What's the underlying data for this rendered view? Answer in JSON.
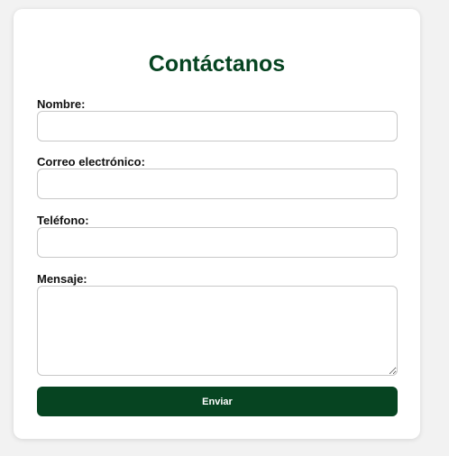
{
  "form": {
    "title": "Contáctanos",
    "fields": {
      "name": {
        "label": "Nombre:",
        "value": "",
        "placeholder": ""
      },
      "email": {
        "label": "Correo electrónico:",
        "value": "",
        "placeholder": ""
      },
      "phone": {
        "label": "Teléfono:",
        "value": "",
        "placeholder": ""
      },
      "message": {
        "label": "Mensaje:",
        "value": "",
        "placeholder": ""
      }
    },
    "submit_label": "Enviar"
  },
  "colors": {
    "accent": "#064421",
    "background": "#f2f2f2",
    "card": "#ffffff"
  }
}
